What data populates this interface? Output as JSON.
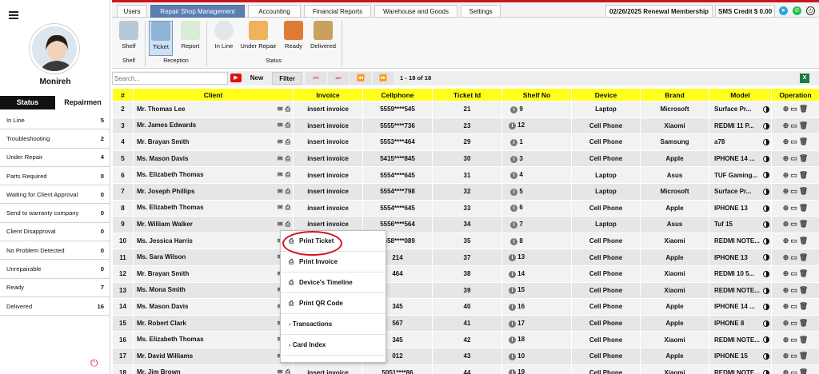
{
  "sidebar": {
    "user_name": "Monireh",
    "tabs": [
      "Status",
      "Repairmen"
    ],
    "status_items": [
      {
        "label": "In Line",
        "count": "5"
      },
      {
        "label": "Troubleshooting",
        "count": "2"
      },
      {
        "label": "Under Repair",
        "count": "4"
      },
      {
        "label": "Parts Required",
        "count": "0"
      },
      {
        "label": "Waiting for Client Approval",
        "count": "0"
      },
      {
        "label": "Send to warranty company",
        "count": "0"
      },
      {
        "label": "Client Disapproval",
        "count": "0"
      },
      {
        "label": "No Problem Detected",
        "count": "0"
      },
      {
        "label": "Unrepairable",
        "count": "0"
      },
      {
        "label": "Ready",
        "count": "7"
      },
      {
        "label": "Delivered",
        "count": "16"
      }
    ]
  },
  "topbar": {
    "tabs": [
      "Users",
      "Repair Shop Management",
      "Accounting",
      "Financial Reports",
      "Warehouse and Goods",
      "Settings"
    ],
    "renewal": "02/26/2025 Renewal Membership",
    "sms": "SMS Credit $ 0.00"
  },
  "ribbon": {
    "buttons": [
      "Shelf",
      "Ticket",
      "Report",
      "In Line",
      "Under Repair",
      "Ready",
      "Delivered"
    ],
    "groups": [
      "Shelf",
      "Reception",
      "Status"
    ]
  },
  "toolbar": {
    "search_placeholder": "Search...",
    "new_label": "New",
    "filter_label": "Filter",
    "page_info": "1 - 18 of 18",
    "nav": [
      "⏮",
      "⏭",
      "⏪",
      "⏩"
    ]
  },
  "table": {
    "headers": [
      "#",
      "Client",
      "Invoice",
      "Cellphone",
      "Ticket Id",
      "Shelf No",
      "Device",
      "Brand",
      "Model",
      "Operation"
    ],
    "rows": [
      {
        "n": "2",
        "client": "Mr. Thomas Lee",
        "invoice": "insert invoice",
        "phone": "5559****545",
        "ticket": "21",
        "shelf": "9",
        "device": "Laptop",
        "brand": "Microsoft",
        "model": "Surface Pr..."
      },
      {
        "n": "3",
        "client": "Mr. James Edwards",
        "invoice": "insert invoice",
        "phone": "5555****736",
        "ticket": "23",
        "shelf": "12",
        "device": "Cell Phone",
        "brand": "Xiaomi",
        "model": "REDMI 11 P..."
      },
      {
        "n": "4",
        "client": "Mr. Brayan Smith",
        "invoice": "insert invoice",
        "phone": "5553****464",
        "ticket": "29",
        "shelf": "1",
        "device": "Cell Phone",
        "brand": "Samsung",
        "model": "a78"
      },
      {
        "n": "5",
        "client": "Ms. Mason Davis",
        "invoice": "insert invoice",
        "phone": "5415****845",
        "ticket": "30",
        "shelf": "3",
        "device": "Cell Phone",
        "brand": "Apple",
        "model": "IPHONE 14 ..."
      },
      {
        "n": "6",
        "client": "Ms. Elizabeth Thomas",
        "invoice": "insert invoice",
        "phone": "5554****645",
        "ticket": "31",
        "shelf": "4",
        "device": "Laptop",
        "brand": "Asus",
        "model": "TUF Gaming..."
      },
      {
        "n": "7",
        "client": "Mr. Joseph Phillips",
        "invoice": "insert invoice",
        "phone": "5554****798",
        "ticket": "32",
        "shelf": "5",
        "device": "Laptop",
        "brand": "Microsoft",
        "model": "Surface Pr..."
      },
      {
        "n": "8",
        "client": "Ms. Elizabeth Thomas",
        "invoice": "insert invoice",
        "phone": "5554****645",
        "ticket": "33",
        "shelf": "6",
        "device": "Cell Phone",
        "brand": "Apple",
        "model": "IPHONE 13"
      },
      {
        "n": "9",
        "client": "Mr. William Walker",
        "invoice": "insert invoice",
        "phone": "5556****564",
        "ticket": "34",
        "shelf": "7",
        "device": "Laptop",
        "brand": "Asus",
        "model": "Tuf 15"
      },
      {
        "n": "10",
        "client": "Ms. Jessica Harris",
        "invoice": "",
        "phone": "5558****089",
        "ticket": "35",
        "shelf": "8",
        "device": "Cell Phone",
        "brand": "Xiaomi",
        "model": "REDMI NOTE..."
      },
      {
        "n": "11",
        "client": "Ms. Sara Wilson",
        "invoice": "",
        "phone": "214",
        "ticket": "37",
        "shelf": "13",
        "device": "Cell Phone",
        "brand": "Apple",
        "model": "IPHONE 13"
      },
      {
        "n": "12",
        "client": "Mr. Brayan Smith",
        "invoice": "",
        "phone": "464",
        "ticket": "38",
        "shelf": "14",
        "device": "Cell Phone",
        "brand": "Xiaomi",
        "model": "REDMI 10 5..."
      },
      {
        "n": "13",
        "client": "Ms. Mona Smith",
        "invoice": "",
        "phone": "",
        "ticket": "39",
        "shelf": "15",
        "device": "Cell Phone",
        "brand": "Xiaomi",
        "model": "REDMI NOTE..."
      },
      {
        "n": "14",
        "client": "Ms. Mason Davis",
        "invoice": "",
        "phone": "345",
        "ticket": "40",
        "shelf": "16",
        "device": "Cell Phone",
        "brand": "Apple",
        "model": "IPHONE 14 ..."
      },
      {
        "n": "15",
        "client": "Mr. Robert Clark",
        "invoice": "",
        "phone": "567",
        "ticket": "41",
        "shelf": "17",
        "device": "Cell Phone",
        "brand": "Apple",
        "model": "IPHONE 8"
      },
      {
        "n": "16",
        "client": "Ms. Elizabeth Thomas",
        "invoice": "",
        "phone": "345",
        "ticket": "42",
        "shelf": "18",
        "device": "Cell Phone",
        "brand": "Xiaomi",
        "model": "REDMI NOTE..."
      },
      {
        "n": "17",
        "client": "Mr. David Williams",
        "invoice": "",
        "phone": "012",
        "ticket": "43",
        "shelf": "10",
        "device": "Cell Phone",
        "brand": "Apple",
        "model": "IPHONE 15"
      },
      {
        "n": "18",
        "client": "Mr. Jim Brown",
        "invoice": "insert invoice",
        "phone": "5051****86",
        "ticket": "44",
        "shelf": "19",
        "device": "Cell Phone",
        "brand": "Xiaomi",
        "model": "REDMI NOTE..."
      }
    ]
  },
  "context_menu": [
    {
      "label": "Print Ticket",
      "icon": "printer-icon"
    },
    {
      "label": "Print Invoice",
      "icon": "printer-icon"
    },
    {
      "label": "Device's Timeline",
      "icon": "printer-icon"
    },
    {
      "label": "Print QR Code",
      "icon": "printer-icon"
    },
    {
      "label": "- Transactions",
      "icon": ""
    },
    {
      "label": "- Card Index",
      "icon": ""
    }
  ],
  "colors": {
    "accent": "#c8161d",
    "header_yellow": "#ffff1a",
    "active_tab": "#5a7fb2"
  }
}
